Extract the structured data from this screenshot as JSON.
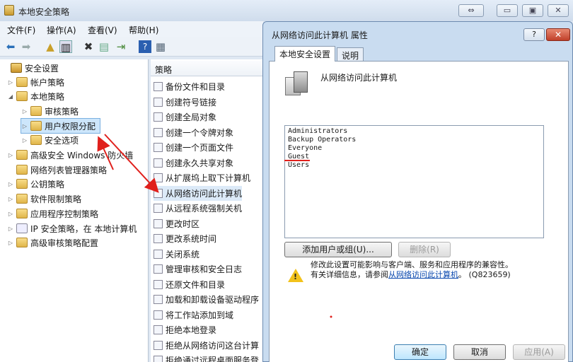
{
  "main_window": {
    "title": "本地安全策略",
    "controls": {
      "restore_label": "⇔",
      "minimize_label": "▭",
      "maximize_label": "▣",
      "close_label": "✕"
    }
  },
  "menu": {
    "file": "文件(F)",
    "action": "操作(A)",
    "view": "查看(V)",
    "help": "帮助(H)"
  },
  "toolbar_icons": [
    "back-arrow-icon",
    "forward-arrow-icon",
    "up-folder-icon",
    "show-tree-icon",
    "delete-icon",
    "properties-icon",
    "export-icon",
    "help-icon",
    "console-icon"
  ],
  "tree": {
    "root": "安全设置",
    "account_policies": "帐户策略",
    "local_policies": "本地策略",
    "audit_policy": "审核策略",
    "user_rights": "用户权限分配",
    "security_options": "安全选项",
    "firewall": "高级安全 Windows 防火墙",
    "network_list": "网络列表管理器策略",
    "public_key": "公钥策略",
    "software_restriction": "软件限制策略",
    "app_control": "应用程序控制策略",
    "ip_security": "IP 安全策略，在 本地计算机",
    "adv_audit": "高级审核策略配置"
  },
  "policy_list": {
    "header": "策略",
    "items": [
      "备份文件和目录",
      "创建符号链接",
      "创建全局对象",
      "创建一个令牌对象",
      "创建一个页面文件",
      "创建永久共享对象",
      "从扩展坞上取下计算机",
      "从网络访问此计算机",
      "从远程系统强制关机",
      "更改时区",
      "更改系统时间",
      "关闭系统",
      "管理审核和安全日志",
      "还原文件和目录",
      "加载和卸载设备驱动程序",
      "将工作站添加到域",
      "拒绝本地登录",
      "拒绝从网络访问这台计算",
      "拒绝通过远程桌面服务登"
    ]
  },
  "dialog": {
    "title": "从网络访问此计算机 属性",
    "help_label": "?",
    "close_label": "✕",
    "tabs": [
      "本地安全设置",
      "说明"
    ],
    "policy_name": "从网络访问此计算机",
    "accounts": [
      "Administrators",
      "Backup Operators",
      "Everyone",
      "Guest",
      "Users"
    ],
    "add_button": "添加用户或组(U)...",
    "remove_button": "删除(R)",
    "warning_line1": "修改此设置可能影响与客户端、服务和应用程序的兼容性。",
    "warning_line2_prefix": "有关详细信息，请参阅",
    "warning_link": "从网络访问此计算机",
    "warning_line2_suffix": "。 (Q823659)",
    "ok": "确定",
    "cancel": "取消",
    "apply": "应用(A)"
  },
  "colors": {
    "annotation": "#e0201c",
    "selection": "#cde6fb",
    "dialog_frame": "#c9dcf0"
  }
}
